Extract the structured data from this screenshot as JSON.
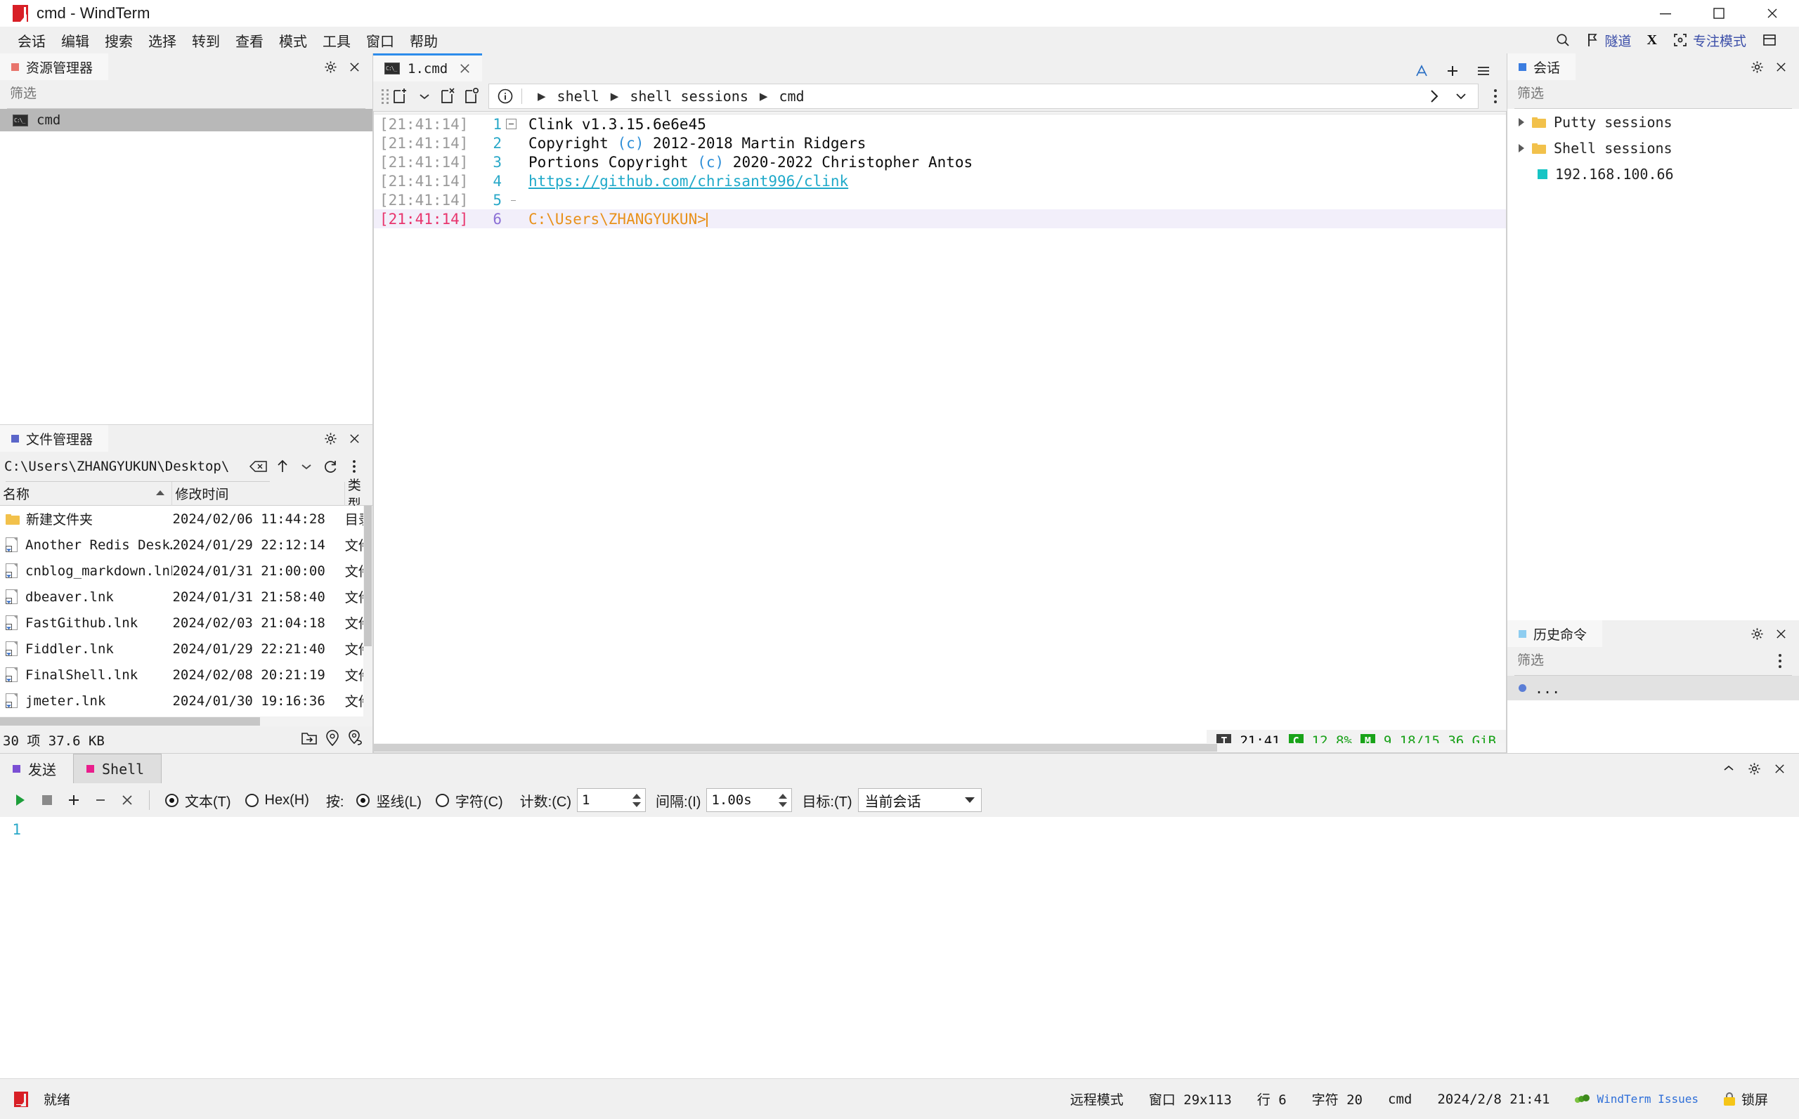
{
  "window": {
    "title": "cmd - WindTerm",
    "controls": {
      "minimize": "minimize-icon",
      "maximize": "maximize-icon",
      "close": "close-icon"
    }
  },
  "menubar": {
    "items": [
      {
        "label": "会话"
      },
      {
        "label": "编辑"
      },
      {
        "label": "搜索"
      },
      {
        "label": "选择"
      },
      {
        "label": "转到"
      },
      {
        "label": "查看"
      },
      {
        "label": "模式"
      },
      {
        "label": "工具"
      },
      {
        "label": "窗口"
      },
      {
        "label": "帮助"
      }
    ],
    "right": {
      "search": "search-icon",
      "tunnel_label": "隧道",
      "x_label": "X",
      "focus_label": "专注模式",
      "layout": "layout-icon"
    }
  },
  "explorer": {
    "title": "资源管理器",
    "filter_placeholder": "筛选",
    "items": [
      {
        "label": "cmd",
        "selected": true
      }
    ]
  },
  "filemanager": {
    "title": "文件管理器",
    "path": "C:\\Users\\ZHANGYUKUN\\Desktop\\",
    "columns": [
      "名称",
      "修改时间",
      "类型"
    ],
    "rows": [
      {
        "icon": "folder",
        "name": "新建文件夹",
        "modified": "2024/02/06 11:44:28",
        "type": "目录"
      },
      {
        "icon": "lnk",
        "name": "Another Redis Desk…",
        "modified": "2024/01/29 22:12:14",
        "type": "文件"
      },
      {
        "icon": "lnk",
        "name": "cnblog_markdown.lnk",
        "modified": "2024/01/31 21:00:00",
        "type": "文件"
      },
      {
        "icon": "lnk",
        "name": "dbeaver.lnk",
        "modified": "2024/01/31 21:58:40",
        "type": "文件"
      },
      {
        "icon": "lnk",
        "name": "FastGithub.lnk",
        "modified": "2024/02/03 21:04:18",
        "type": "文件"
      },
      {
        "icon": "lnk",
        "name": "Fiddler.lnk",
        "modified": "2024/01/29 22:21:40",
        "type": "文件"
      },
      {
        "icon": "lnk",
        "name": "FinalShell.lnk",
        "modified": "2024/02/08 20:21:19",
        "type": "文件"
      },
      {
        "icon": "lnk",
        "name": "jmeter.lnk",
        "modified": "2024/01/30 19:16:36",
        "type": "文件"
      }
    ],
    "status": "30 项 37.6 KB"
  },
  "terminal": {
    "tab": {
      "label": "1.cmd",
      "icon": "cmd-icon"
    },
    "toolbar_right": {
      "font": "A",
      "add": "+",
      "menu": "≡"
    },
    "breadcrumb": [
      "shell",
      "shell sessions",
      "cmd"
    ],
    "lines": [
      {
        "time": "[21:41:14]",
        "num": "1",
        "fold": "start",
        "text": "Clink v1.3.15.6e6e45"
      },
      {
        "time": "[21:41:14]",
        "num": "2",
        "fold": "mid",
        "text": "Copyright (c) 2012-2018 Martin Ridgers"
      },
      {
        "time": "[21:41:14]",
        "num": "3",
        "fold": "mid",
        "text": "Portions Copyright (c) 2020-2022 Christopher Antos"
      },
      {
        "time": "[21:41:14]",
        "num": "4",
        "fold": "mid",
        "text": "https://github.com/chrisant996/clink"
      },
      {
        "time": "[21:41:14]",
        "num": "5",
        "fold": "end",
        "text": ""
      },
      {
        "time": "[21:41:14]",
        "num": "6",
        "fold": "none",
        "text": "C:\\Users\\ZHANGYUKUN>",
        "current": true
      }
    ],
    "status": {
      "time_badge": "T",
      "time": "21:41",
      "cpu_badge": "C",
      "cpu": "12.8%",
      "mem_badge": "M",
      "mem": "9.18/15.36 GiB"
    }
  },
  "sessions": {
    "title": "会话",
    "filter_placeholder": "筛选",
    "items": [
      {
        "label": "Putty sessions",
        "icon": "folder",
        "expandable": true
      },
      {
        "label": "Shell sessions",
        "icon": "folder",
        "expandable": true
      },
      {
        "label": "192.168.100.66",
        "icon": "session",
        "expandable": false
      }
    ]
  },
  "history": {
    "title": "历史命令",
    "filter_placeholder": "筛选",
    "items": [
      {
        "label": "..."
      }
    ]
  },
  "send": {
    "tabs": [
      {
        "label": "发送",
        "color": "#7b4fd4",
        "active": false
      },
      {
        "label": "Shell",
        "color": "#e91e8c",
        "active": true
      }
    ],
    "toolbar": {
      "run": "▶",
      "stop": "■",
      "add": "+",
      "remove": "−",
      "clear": "×",
      "mode_text": "文本(T)",
      "mode_hex": "Hex(H)",
      "press_label": "按:",
      "press_line": "竖线(L)",
      "press_char": "字符(C)",
      "count_label": "计数:(C)",
      "count_value": "1",
      "interval_label": "间隔:(I)",
      "interval_value": "1.00s",
      "target_label": "目标:(T)",
      "target_value": "当前会话"
    },
    "editor": {
      "line_number": "1",
      "content": ""
    }
  },
  "statusbar": {
    "ready": "就绪",
    "remote_mode": "远程模式",
    "window_size": "窗口 29x113",
    "row": "行 6",
    "chars": "字符 20",
    "shell": "cmd",
    "datetime": "2024/2/8 21:41",
    "issues": "WindTerm Issues",
    "lock": "锁屏"
  }
}
